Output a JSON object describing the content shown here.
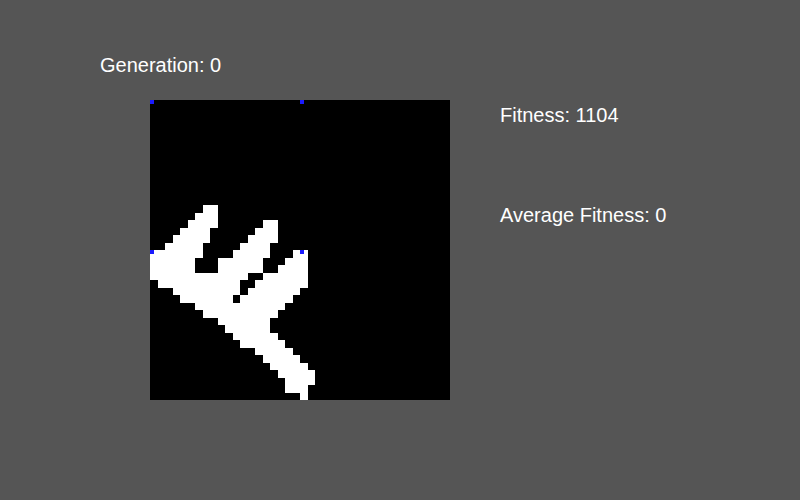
{
  "labels": {
    "generation": "Generation: 0",
    "fitness": "Fitness: 1104",
    "average_fitness": "Average Fitness: 0"
  },
  "canvas": {
    "grid": 40,
    "markers": [
      [
        0,
        0
      ],
      [
        20,
        0
      ],
      [
        0,
        20
      ],
      [
        20,
        20
      ]
    ],
    "rows": [
      {
        "row": 14,
        "spans": [
          [
            7,
            8
          ]
        ]
      },
      {
        "row": 15,
        "spans": [
          [
            6,
            8
          ]
        ]
      },
      {
        "row": 16,
        "spans": [
          [
            5,
            8
          ],
          [
            15,
            16
          ]
        ]
      },
      {
        "row": 17,
        "spans": [
          [
            4,
            7
          ],
          [
            14,
            16
          ]
        ]
      },
      {
        "row": 18,
        "spans": [
          [
            3,
            7
          ],
          [
            13,
            16
          ]
        ]
      },
      {
        "row": 19,
        "spans": [
          [
            2,
            6
          ],
          [
            12,
            15
          ]
        ]
      },
      {
        "row": 20,
        "spans": [
          [
            0,
            6
          ],
          [
            11,
            15
          ],
          [
            19,
            20
          ]
        ]
      },
      {
        "row": 21,
        "spans": [
          [
            0,
            5
          ],
          [
            9,
            14
          ],
          [
            18,
            20
          ]
        ]
      },
      {
        "row": 22,
        "spans": [
          [
            0,
            5
          ],
          [
            9,
            14
          ],
          [
            17,
            20
          ]
        ]
      },
      {
        "row": 23,
        "spans": [
          [
            0,
            12
          ],
          [
            15,
            20
          ]
        ]
      },
      {
        "row": 24,
        "spans": [
          [
            1,
            11
          ],
          [
            14,
            20
          ]
        ]
      },
      {
        "row": 25,
        "spans": [
          [
            3,
            11
          ],
          [
            13,
            19
          ]
        ]
      },
      {
        "row": 26,
        "spans": [
          [
            4,
            10
          ],
          [
            12,
            18
          ]
        ]
      },
      {
        "row": 27,
        "spans": [
          [
            6,
            17
          ]
        ]
      },
      {
        "row": 28,
        "spans": [
          [
            7,
            16
          ]
        ]
      },
      {
        "row": 29,
        "spans": [
          [
            9,
            15
          ]
        ]
      },
      {
        "row": 30,
        "spans": [
          [
            10,
            15
          ]
        ]
      },
      {
        "row": 31,
        "spans": [
          [
            11,
            16
          ]
        ]
      },
      {
        "row": 32,
        "spans": [
          [
            12,
            17
          ]
        ]
      },
      {
        "row": 33,
        "spans": [
          [
            14,
            18
          ]
        ]
      },
      {
        "row": 34,
        "spans": [
          [
            15,
            19
          ]
        ]
      },
      {
        "row": 35,
        "spans": [
          [
            16,
            20
          ]
        ]
      },
      {
        "row": 36,
        "spans": [
          [
            17,
            21
          ]
        ]
      },
      {
        "row": 37,
        "spans": [
          [
            18,
            21
          ]
        ]
      },
      {
        "row": 38,
        "spans": [
          [
            18,
            20
          ]
        ]
      },
      {
        "row": 39,
        "spans": [
          [
            20,
            20
          ]
        ]
      }
    ]
  }
}
